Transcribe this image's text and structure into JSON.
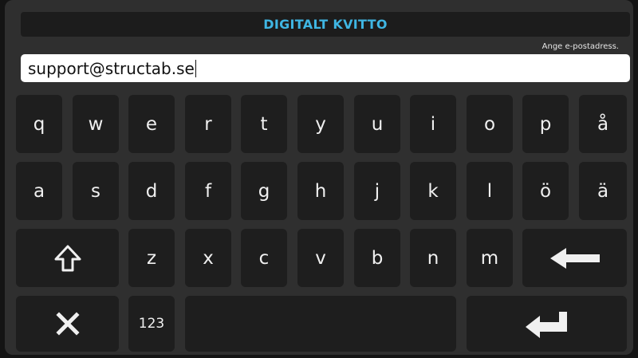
{
  "header": {
    "title": "DIGITALT KVITTO"
  },
  "input": {
    "hint": "Ange e-postadress.",
    "value": "support@structab.se"
  },
  "keyboard": {
    "row1": [
      "q",
      "w",
      "e",
      "r",
      "t",
      "y",
      "u",
      "i",
      "o",
      "p",
      "å"
    ],
    "row2": [
      "a",
      "s",
      "d",
      "f",
      "g",
      "h",
      "j",
      "k",
      "l",
      "ö",
      "ä"
    ],
    "row3": [
      "z",
      "x",
      "c",
      "v",
      "b",
      "n",
      "m"
    ],
    "numbers_label": "123",
    "icons": {
      "shift": "shift-arrow-icon",
      "backspace": "backspace-arrow-icon",
      "close": "close-x-icon",
      "enter": "enter-return-icon"
    }
  },
  "colors": {
    "title": "#3fb6e3",
    "key": "#1e1e1e",
    "panel": "#2f2f2f"
  }
}
